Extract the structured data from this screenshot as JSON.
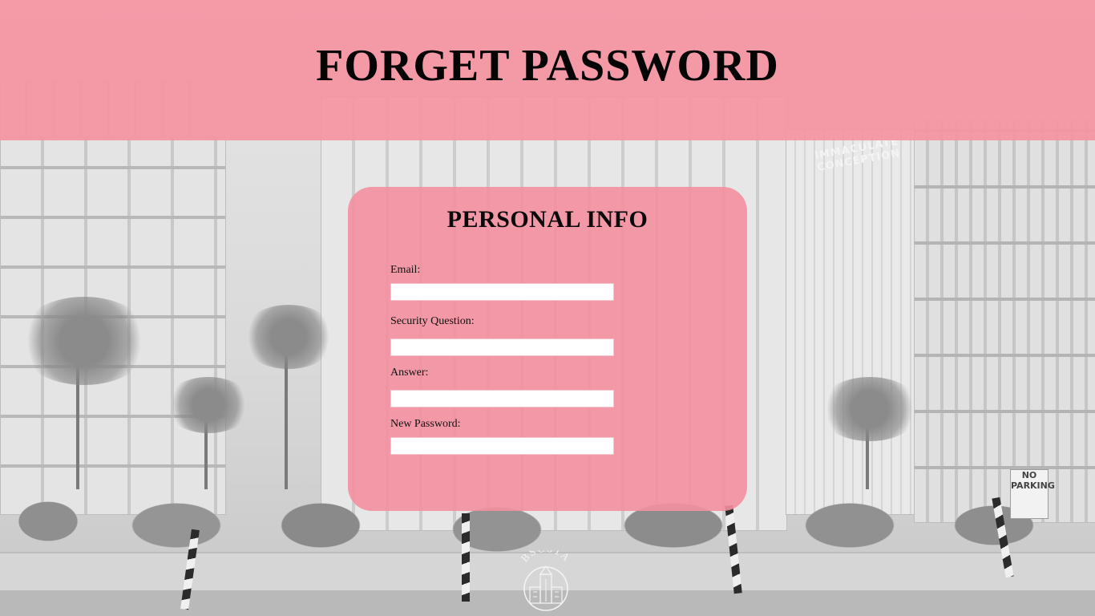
{
  "page": {
    "title": "FORGET PASSWORD"
  },
  "background": {
    "building_sign": "IMMACULATE CONCEPTION",
    "street_sign": "NO PARKING"
  },
  "form": {
    "title": "PERSONAL INFO",
    "fields": [
      {
        "label": "Email:",
        "value": "",
        "placeholder": ""
      },
      {
        "label": "Security Question:",
        "value": "",
        "placeholder": ""
      },
      {
        "label": "Answer:",
        "value": "",
        "placeholder": ""
      },
      {
        "label": "New Password:",
        "value": "",
        "placeholder": ""
      }
    ]
  },
  "logo": {
    "text": "BSCS1A",
    "icon": "school-tower-emblem-icon"
  },
  "colors": {
    "header_bg": "#f594a2",
    "card_bg": "#f48f9e",
    "title_text": "#050505",
    "input_bg": "#ffffff"
  }
}
